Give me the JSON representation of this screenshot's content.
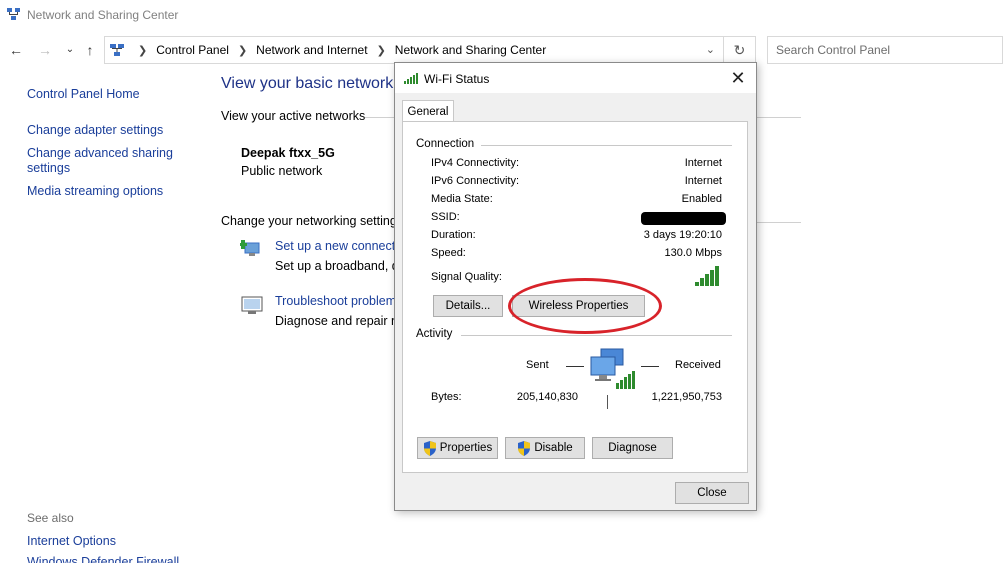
{
  "window": {
    "title": "Network and Sharing Center"
  },
  "address_bar": {
    "crumbs": [
      "Control Panel",
      "Network and Internet",
      "Network and Sharing Center"
    ]
  },
  "search": {
    "placeholder": "Search Control Panel"
  },
  "left_pane": {
    "links": [
      "Control Panel Home",
      "Change adapter settings",
      "Change advanced sharing settings",
      "Media streaming options"
    ],
    "see_also_label": "See also",
    "see_also_links": [
      "Internet Options",
      "Windows Defender Firewall"
    ]
  },
  "main": {
    "title": "View your basic network",
    "active_networks_label": "View your active networks",
    "network_name": "Deepak ftxx_5G",
    "network_type": "Public network",
    "change_settings_label": "Change your networking settings",
    "tasks": [
      {
        "link": "Set up a new connectio",
        "desc": "Set up a broadband, di"
      },
      {
        "link": "Troubleshoot problems",
        "desc": "Diagnose and repair ne"
      }
    ]
  },
  "dialog": {
    "title": "Wi-Fi Status",
    "tab": "General",
    "connection": {
      "label": "Connection",
      "rows": [
        {
          "key": "IPv4 Connectivity:",
          "value": "Internet"
        },
        {
          "key": "IPv6 Connectivity:",
          "value": "Internet"
        },
        {
          "key": "Media State:",
          "value": "Enabled"
        },
        {
          "key": "SSID:",
          "value": ""
        },
        {
          "key": "Duration:",
          "value": "3 days 19:20:10"
        },
        {
          "key": "Speed:",
          "value": "130.0 Mbps"
        }
      ],
      "signal_label": "Signal Quality:",
      "signal_bars": 5
    },
    "buttons": {
      "details": "Details...",
      "wireless_properties": "Wireless Properties",
      "properties": "Properties",
      "disable": "Disable",
      "diagnose": "Diagnose",
      "close": "Close"
    },
    "activity": {
      "label": "Activity",
      "sent_label": "Sent",
      "received_label": "Received",
      "bytes_label": "Bytes:",
      "bytes_sent": "205,140,830",
      "bytes_received": "1,221,950,753"
    }
  },
  "colors": {
    "link": "#1a3e9a",
    "heading": "#1e3287",
    "highlight": "#d8232a",
    "signal": "#2e8b2e"
  }
}
